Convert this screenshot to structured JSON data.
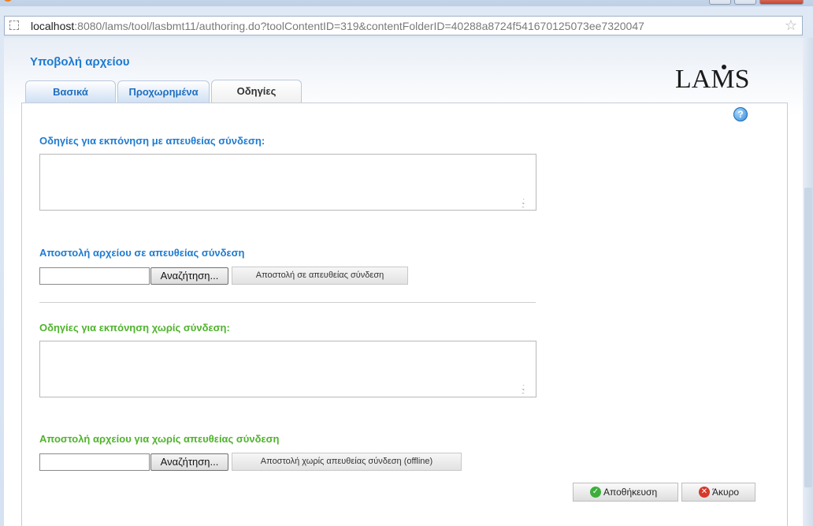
{
  "browser": {
    "address": {
      "host": "localhost",
      "rest": ":8080/lams/tool/lasbmt11/authoring.do?toolContentID=319&contentFolderID=40288a8724f541670125073ee7320047"
    },
    "bookmark_icon": "star-icon"
  },
  "page": {
    "title": "Υποβολή αρχείου",
    "logo": {
      "pre": "LA",
      "m": "M",
      "post": "S"
    }
  },
  "tabs": [
    {
      "label": "Βασικά",
      "active": false
    },
    {
      "label": "Προχωρημένα",
      "active": false
    },
    {
      "label": "Οδηγίες",
      "active": true
    }
  ],
  "online": {
    "instructions_label": "Οδηγίες για εκπόνηση με απευθείας σύνδεση:",
    "upload_label": "Αποστολή αρχείου σε απευθείας σύνδεση",
    "browse_label": "Αναζήτηση...",
    "upload_button": "Αποστολή σε απευθείας σύνδεση"
  },
  "offline": {
    "instructions_label": "Οδηγίες για εκπόνηση χωρίς σύνδεση:",
    "upload_label": "Αποστολή αρχείου για χωρίς απευθείας σύνδεση",
    "browse_label": "Αναζήτηση...",
    "upload_button": "Αποστολή χωρίς απευθείας σύνδεση (offline)"
  },
  "actions": {
    "save_label": "Αποθήκευση",
    "cancel_label": "Άκυρο"
  },
  "colors": {
    "blue_label": "#1e7bd0",
    "green_label": "#4fb32c"
  }
}
